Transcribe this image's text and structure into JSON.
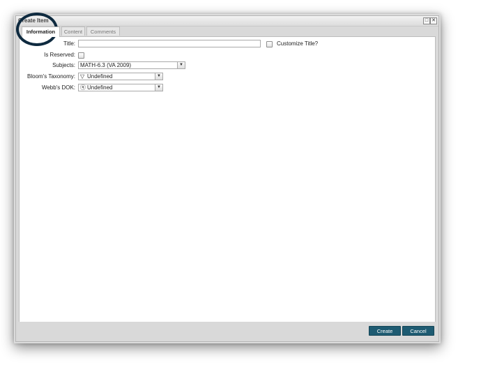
{
  "dialog": {
    "title": "Create Item",
    "maximize_icon": "maximize-icon",
    "close_icon": "close-icon"
  },
  "tabs": [
    {
      "label": "Information",
      "active": true
    },
    {
      "label": "Content",
      "active": false
    },
    {
      "label": "Comments",
      "active": false
    }
  ],
  "form": {
    "title_label": "Title:",
    "title_value": "",
    "customize_title_label": "Customize Title?",
    "is_reserved_label": "Is Reserved:",
    "subjects_label": "Subjects:",
    "subjects_value": "MATH-6.3 (VA 2009)",
    "blooms_label": "Bloom's Taxonomy:",
    "blooms_value": "Undefined",
    "blooms_icon": "pyramid-icon",
    "webbs_label": "Webb's DOK:",
    "webbs_value": "Undefined",
    "webbs_icon": "question-circle-icon"
  },
  "footer": {
    "create_label": "Create",
    "cancel_label": "Cancel"
  },
  "colors": {
    "button_bg": "#1e5b72",
    "annotation_ring": "#0e2a3f"
  }
}
